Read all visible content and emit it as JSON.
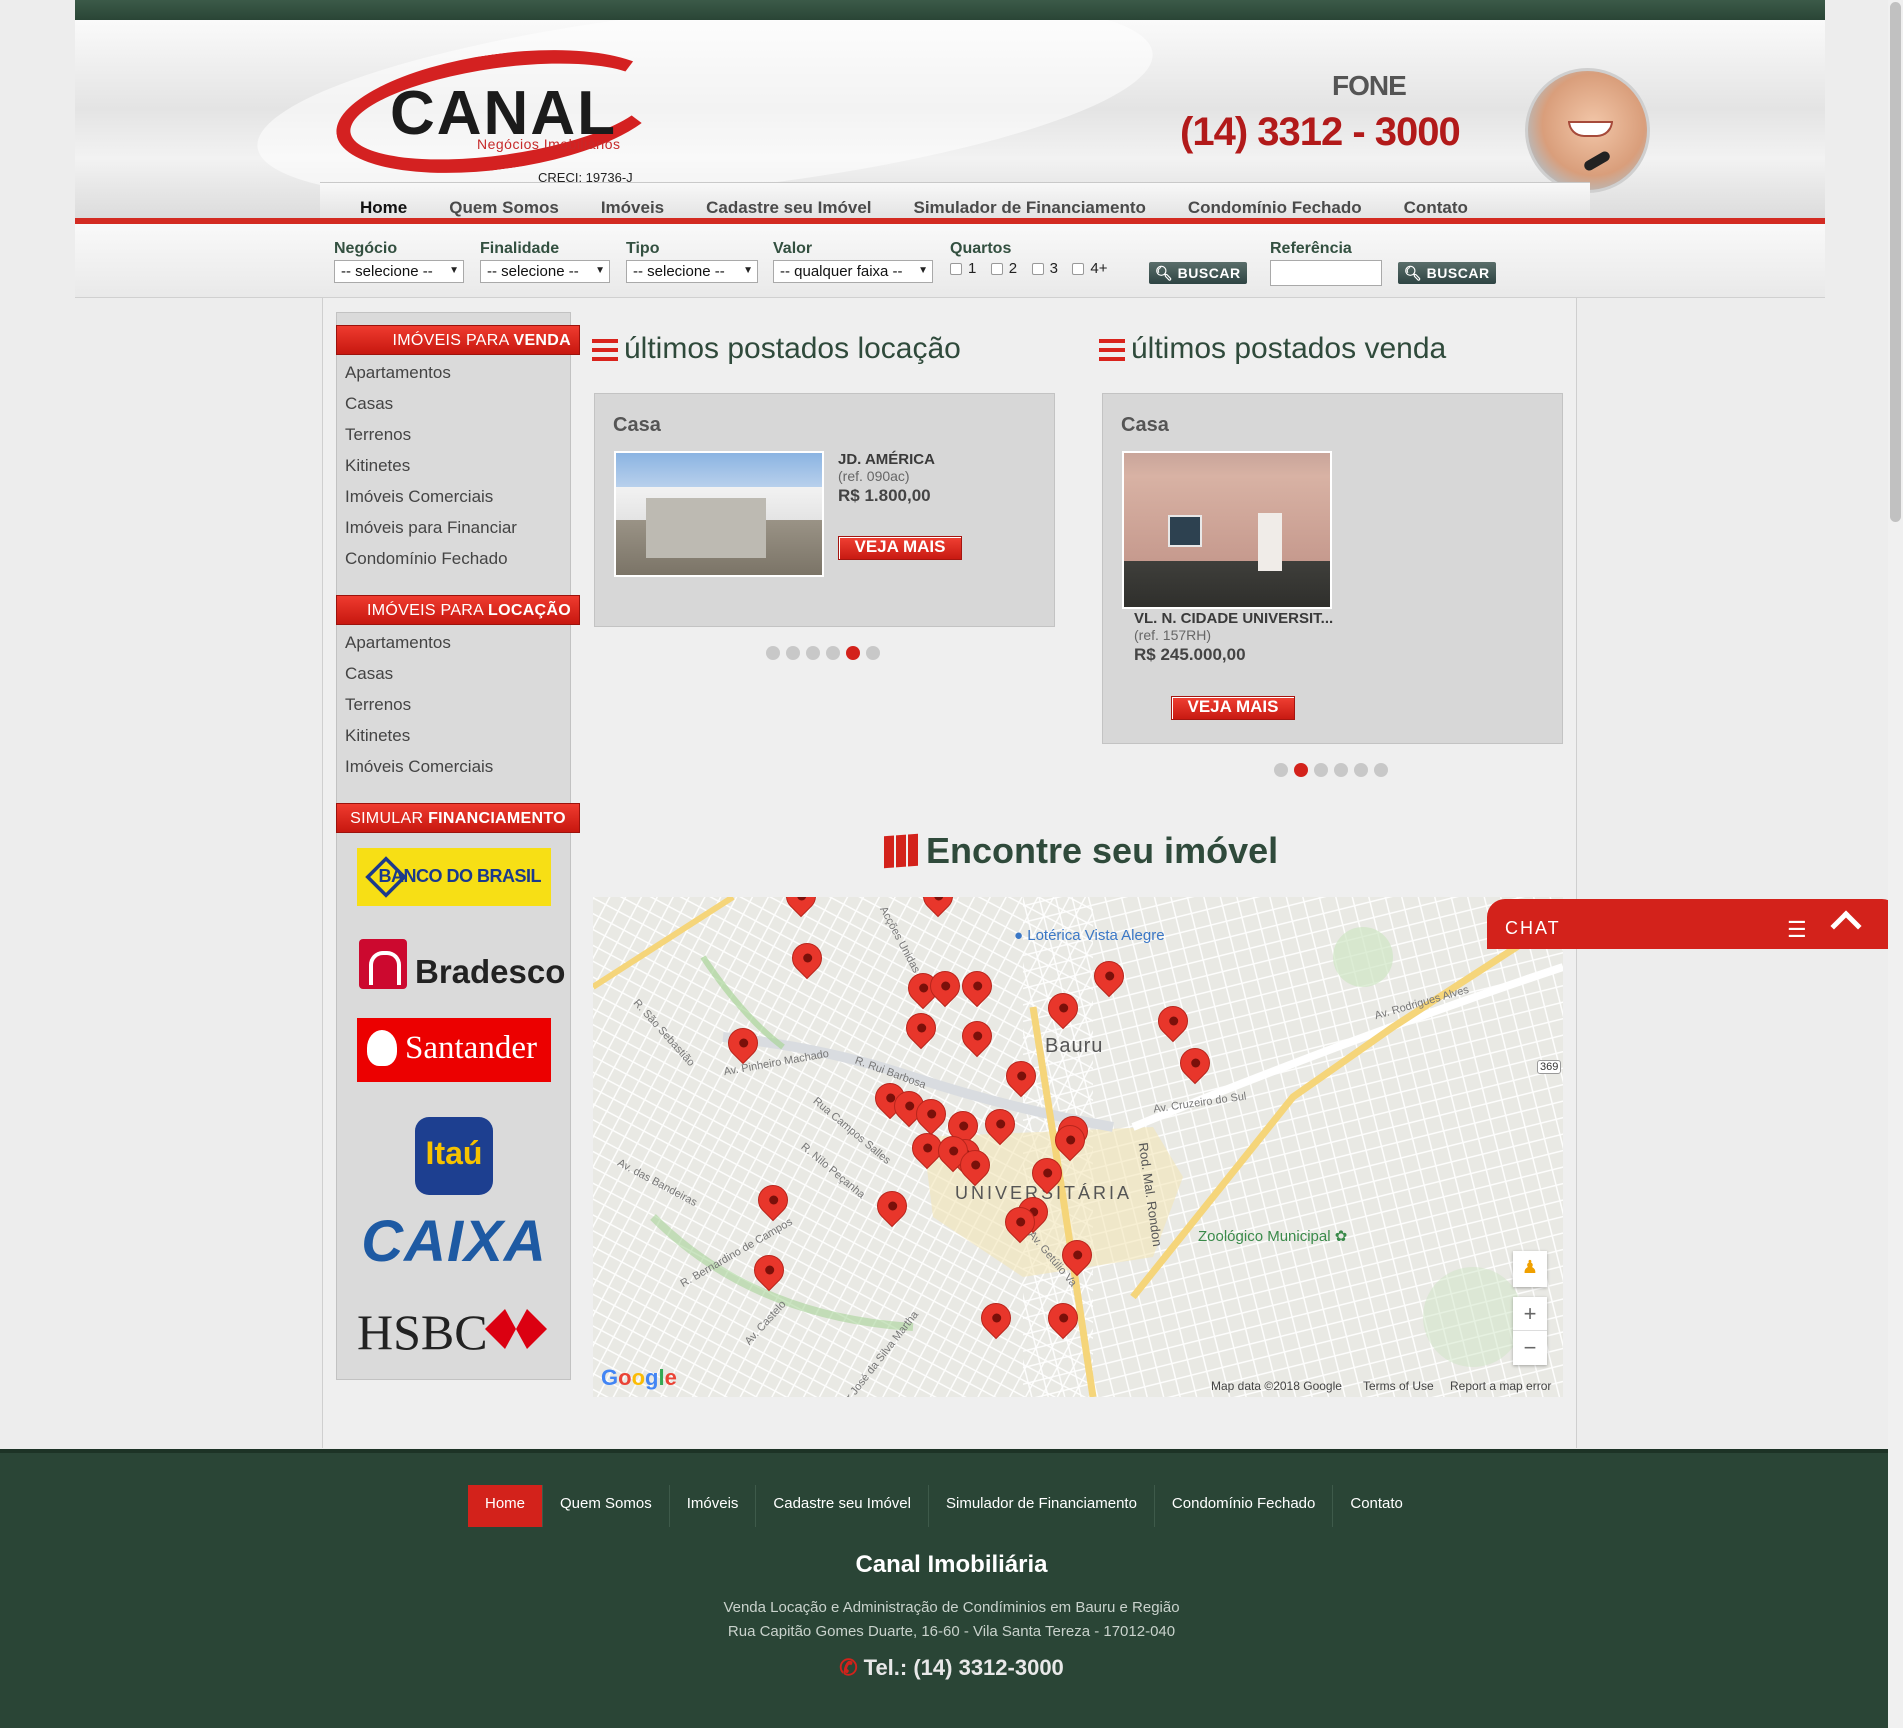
{
  "header": {
    "brand": "CANAL",
    "brand_sub": "Negócios Imobiliários",
    "creci": "CRECI: 19736-J",
    "phone_label": "FONE",
    "phone_number": "(14) 3312 - 3000"
  },
  "nav": [
    "Home",
    "Quem Somos",
    "Imóveis",
    "Cadastre seu Imóvel",
    "Simulador de Financiamento",
    "Condomínio Fechado",
    "Contato"
  ],
  "search": {
    "negocio_label": "Negócio",
    "negocio_value": "-- selecione --",
    "finalidade_label": "Finalidade",
    "finalidade_value": "-- selecione --",
    "tipo_label": "Tipo",
    "tipo_value": "-- selecione --",
    "valor_label": "Valor",
    "valor_value": "-- qualquer faixa --",
    "quartos_label": "Quartos",
    "quartos": [
      "1",
      "2",
      "3",
      "4+"
    ],
    "buscar_label": "BUSCAR",
    "referencia_label": "Referência",
    "referencia_value": ""
  },
  "sidebar": {
    "venda_head_a": "IMÓVEIS PARA ",
    "venda_head_b": "VENDA",
    "venda_items": [
      "Apartamentos",
      "Casas",
      "Terrenos",
      "Kitinetes",
      "Imóveis Comerciais",
      "Imóveis para Financiar",
      "Condomínio Fechado"
    ],
    "locacao_head_a": "IMÓVEIS PARA ",
    "locacao_head_b": "LOCAÇÃO",
    "locacao_items": [
      "Apartamentos",
      "Casas",
      "Terrenos",
      "Kitinetes",
      "Imóveis Comerciais"
    ],
    "sim_head_a": "SIMULAR ",
    "sim_head_b": "FINANCIAMENTO",
    "banks": [
      "BANCO DO BRASIL",
      "Bradesco",
      "Santander",
      "Itaú",
      "CAIXA",
      "HSBC"
    ]
  },
  "locacao": {
    "title": "últimos postados locação",
    "type": "Casa",
    "location": "JD. AMÉRICA",
    "ref": "(ref. 090ac)",
    "price": "R$ 1.800,00",
    "cta": "VEJA MAIS",
    "dots_total": 6,
    "dot_active": 5
  },
  "venda": {
    "title": "últimos postados venda",
    "type": "Casa",
    "location": "VL. N. CIDADE UNIVERSIT...",
    "ref": "(ref. 157RH)",
    "price": "R$ 245.000,00",
    "cta": "VEJA MAIS",
    "dots_total": 6,
    "dot_active": 2
  },
  "map": {
    "title": "Encontre seu imóvel",
    "labels": {
      "loterica": "Lotérica Vista Alegre",
      "bauru": "Bauru",
      "vila": "UNIVERSITÁRIA",
      "zoo": "Zoológico Municipal",
      "rodovia": "Rod. Mal. Rondon",
      "unidas": "Acções Unidas Norte",
      "sao_sebastiao": "R. São Sebastião",
      "pinheiro": "Av. Pinheiro Machado",
      "rui": "R. Rui Barbosa",
      "campos_salles": "Rua Campos Salles",
      "nilo": "R. Nilo Peçanha",
      "bandeiras": "Av. das Bandeiras",
      "bernardino": "R. Bernardino de Campos",
      "castelo": "Av. Castelo",
      "cruzeiro": "Av. Cruzeiro do Sul",
      "rodrigues": "Av. Rodrigues Alves",
      "getulio": "Av. Getúlio Va",
      "jose_silva": "ador José da Silva Martha",
      "route": "369"
    },
    "google": "Google",
    "map_data": "Map data ©2018 Google",
    "terms": "Terms of Use",
    "report": "Report a map error",
    "zoom_in": "+",
    "zoom_out": "−"
  },
  "chat": {
    "label": "CHAT"
  },
  "footer": {
    "nav": [
      "Home",
      "Quem Somos",
      "Imóveis",
      "Cadastre seu Imóvel",
      "Simulador de Financiamento",
      "Condomínio Fechado",
      "Contato"
    ],
    "title": "Canal Imobiliária",
    "line1": "Venda Locação e Administração de Condíminios em Bauru e Região",
    "line2": "Rua Capitão Gomes Duarte, 16-60 - Vila Santa Tereza - 17012-040",
    "tel": "Tel.: (14) 3312-3000"
  }
}
